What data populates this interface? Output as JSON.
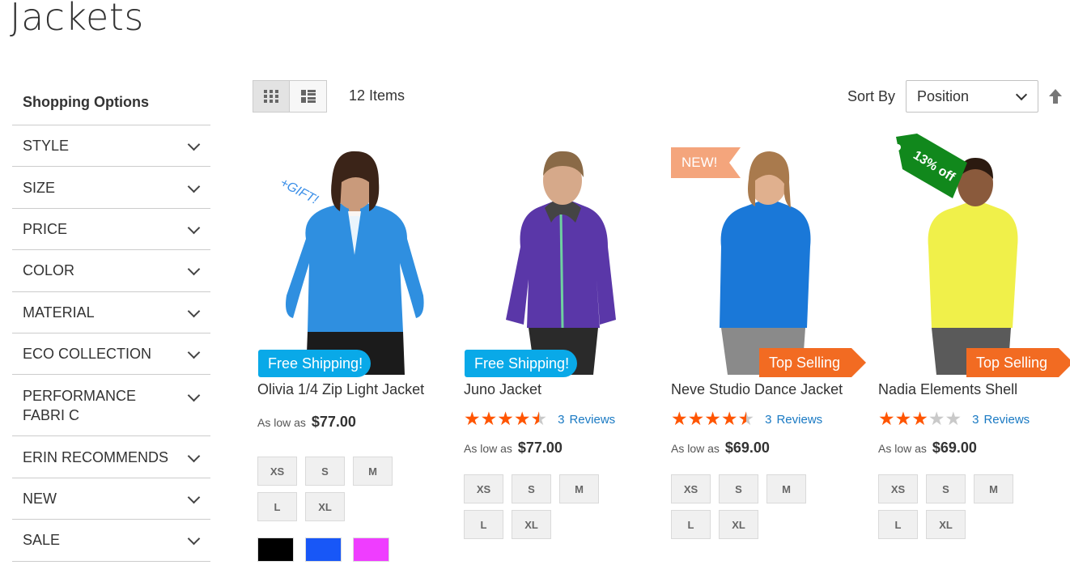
{
  "page": {
    "title": "Jackets"
  },
  "sidebar": {
    "title": "Shopping Options",
    "filters": [
      {
        "label": "STYLE"
      },
      {
        "label": "SIZE"
      },
      {
        "label": "PRICE"
      },
      {
        "label": "COLOR"
      },
      {
        "label": "MATERIAL"
      },
      {
        "label": "ECO COLLECTION"
      },
      {
        "label": "PERFORMANCE FABRI C"
      },
      {
        "label": "ERIN RECOMMENDS"
      },
      {
        "label": "NEW"
      },
      {
        "label": "SALE"
      }
    ]
  },
  "toolbar": {
    "item_count": "12 Items",
    "sort_label": "Sort By",
    "sort_value": "Position",
    "view_modes": [
      "grid-icon",
      "list-icon"
    ],
    "sort_direction_icon": "arrow-up-icon"
  },
  "products": [
    {
      "name": "Olivia 1/4 Zip Light Jacket",
      "price_prefix": "As low as",
      "price": "$77.00",
      "badge": "Free Shipping!",
      "sticker": "+GIFT!",
      "sizes": [
        "XS",
        "S",
        "M",
        "L",
        "XL"
      ],
      "colors": [
        "#000000",
        "#1857f7",
        "#ef3dff"
      ],
      "jacket_color": "#2f8fe0"
    },
    {
      "name": "Juno Jacket",
      "rating": 4.5,
      "reviews_count": "3",
      "reviews_label": "Reviews",
      "price_prefix": "As low as",
      "price": "$77.00",
      "badge": "Free Shipping!",
      "sizes": [
        "XS",
        "S",
        "M",
        "L",
        "XL"
      ],
      "jacket_color": "#5a37a8"
    },
    {
      "name": "Neve Studio Dance Jacket",
      "rating": 4.5,
      "reviews_count": "3",
      "reviews_label": "Reviews",
      "price_prefix": "As low as",
      "price": "$69.00",
      "badge": "Top Selling",
      "sticker": "NEW!",
      "sizes": [
        "XS",
        "S",
        "M",
        "L",
        "XL"
      ],
      "jacket_color": "#1a78d8"
    },
    {
      "name": "Nadia Elements Shell",
      "rating": 3,
      "reviews_count": "3",
      "reviews_label": "Reviews",
      "price_prefix": "As low as",
      "price": "$69.00",
      "badge": "Top Selling",
      "sticker": "13% off",
      "sizes": [
        "XS",
        "S",
        "M",
        "L",
        "XL"
      ],
      "jacket_color": "#f0f04a"
    }
  ],
  "colors": {
    "free_shipping": "#09a9e8",
    "top_selling": "#f26b22",
    "new_badge": "#f4a57c",
    "discount_tag": "#11881c",
    "star": "#ff5501",
    "link": "#1979c3"
  }
}
